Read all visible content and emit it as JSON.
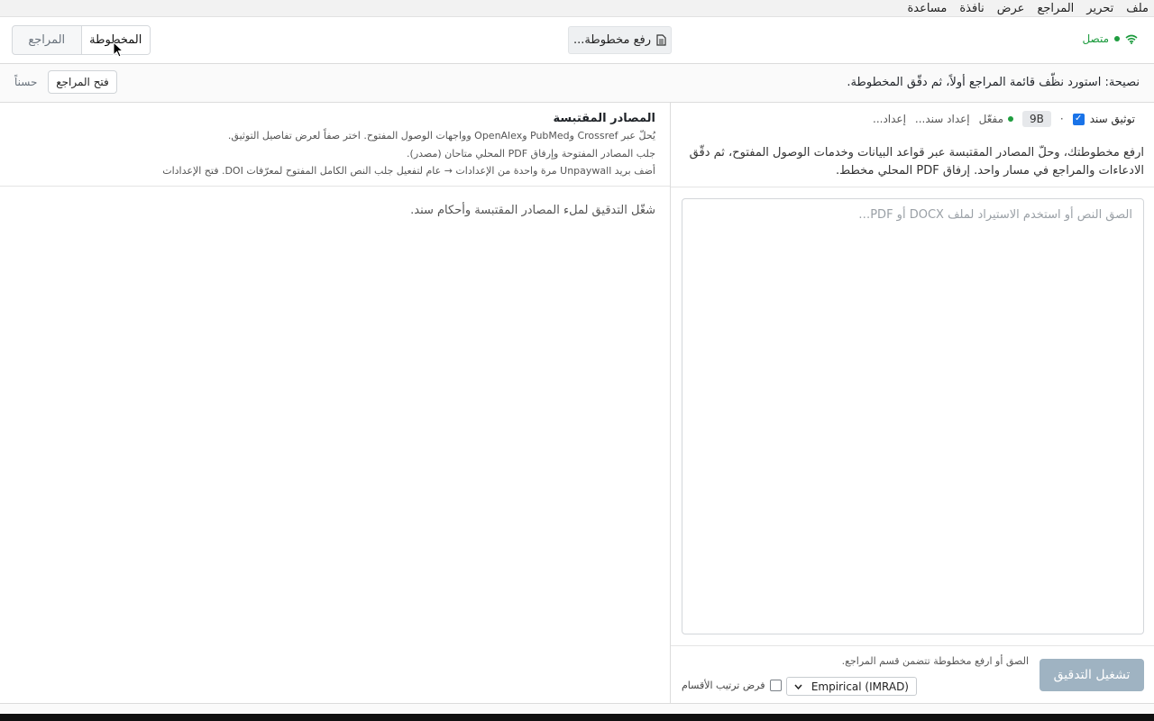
{
  "menubar": {
    "items": [
      "ملف",
      "تحرير",
      "المراجع",
      "عرض",
      "نافذة",
      "مساعدة"
    ]
  },
  "toolbar": {
    "connection": {
      "label": "متصل",
      "icon": "wifi-icon",
      "color": "#1a9a3c"
    },
    "upload_label": "رفع مخطوطة...",
    "upload_icon": "document-icon",
    "tabs": [
      {
        "label": "المخطوطة",
        "active": true
      },
      {
        "label": "المراجع",
        "active": false
      }
    ]
  },
  "tip": {
    "text": "نصيحة: استورد نظّف قائمة المراجع أولاً، ثم دقّق المخطوطة.",
    "open_refs_label": "فتح المراجع",
    "dismiss_label": "حسناً"
  },
  "manuscript": {
    "controls": {
      "setup": "إعداد...",
      "sanad_setup": "إعداد سند...",
      "enabled": "مفعّل",
      "model_chip": "9B",
      "separator": "·",
      "sanad_verify_label": "توثيق سند",
      "sanad_verify_checked": true
    },
    "intro": "ارفع مخطوطتك، وحلّ المصادر المقتبسة عبر قواعد البيانات وخدمات الوصول المفتوح، ثم دقّق الادعاءات والمراجع في مسار واحد. إرفاق PDF المحلي مخطط.",
    "textarea_placeholder": "الصق النص أو استخدم الاستيراد لملف DOCX أو PDF…",
    "paste_hint": "الصق أو ارفع مخطوطة تتضمن قسم المراجع.",
    "run_label": "تشغيل التدقيق",
    "mode": {
      "selected": "Empirical (IMRAD)"
    },
    "enforce_label": "فرض ترتيب الأقسام",
    "enforce_checked": false
  },
  "cited_sources": {
    "title": "المصادر المقتبسة",
    "line1": "يُحلّ عبر Crossref وPubMed وOpenAlex وواجهات الوصول المفتوح. اختر صفاً لعرض تفاصيل التوثيق.",
    "line2": "جلب المصادر المفتوحة وإرفاق PDF المحلي متاحان (مصدر).",
    "line3": "أضف بريد Unpaywall مرة واحدة من الإعدادات → عام لتفعيل جلب النص الكامل المفتوح لمعرّفات DOI. فتح الإعدادات",
    "empty_state": "شغّل التدقيق لملء المصادر المقتبسة وأحكام سند."
  },
  "colors": {
    "accent": "#1a73e8",
    "run_button_disabled": "#9fb3c2",
    "status_green": "#1f9d3f"
  }
}
